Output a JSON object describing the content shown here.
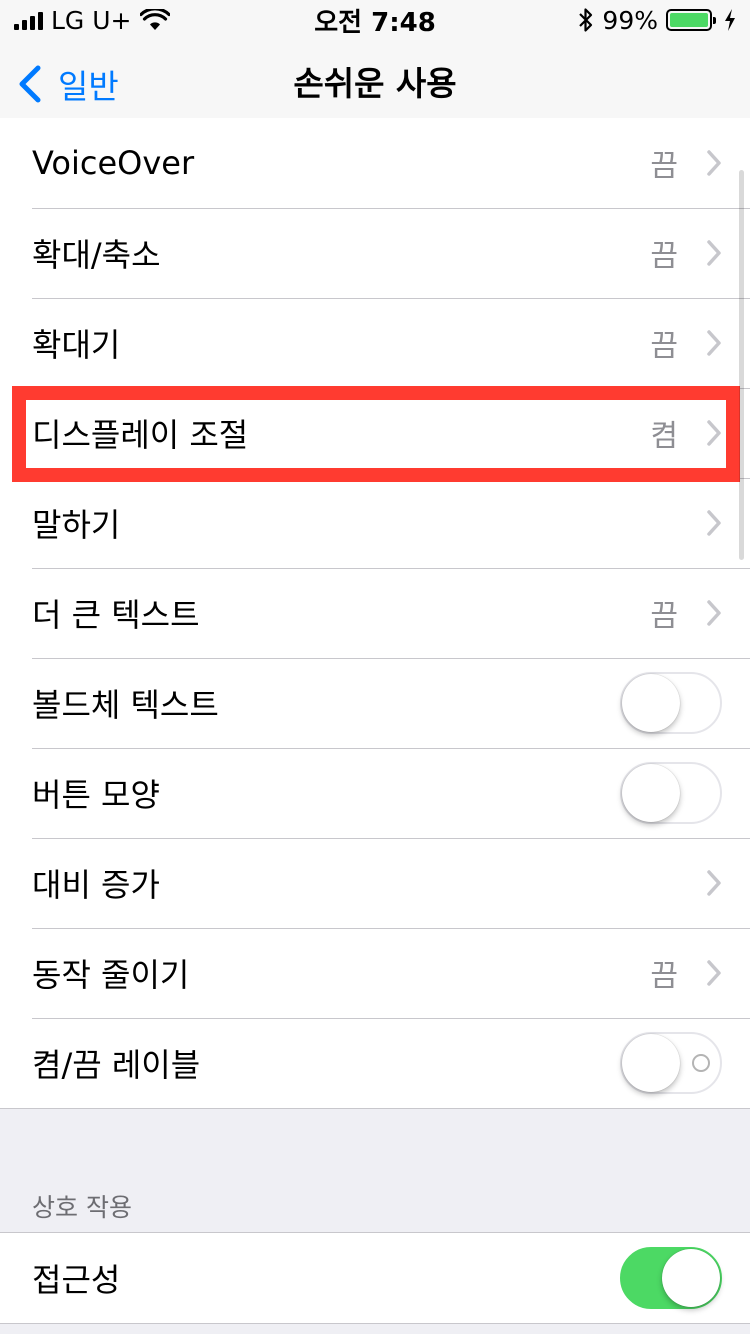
{
  "status_bar": {
    "carrier": "LG U+",
    "time": "오전 7:48",
    "battery_percent": "99%",
    "battery_level": 0.99,
    "icons": [
      "signal-icon",
      "wifi-icon",
      "bluetooth-icon",
      "battery-icon",
      "charging-icon"
    ]
  },
  "nav": {
    "back_label": "일반",
    "title": "손쉬운 사용"
  },
  "rows": [
    {
      "label": "VoiceOver",
      "value": "끔"
    },
    {
      "label": "확대/축소",
      "value": "끔"
    },
    {
      "label": "확대기",
      "value": "끔"
    },
    {
      "label": "디스플레이 조절",
      "value": "켬"
    },
    {
      "label": "말하기"
    },
    {
      "label": "더 큰 텍스트",
      "value": "끔"
    },
    {
      "label": "볼드체 텍스트",
      "toggle": false
    },
    {
      "label": "버튼 모양",
      "toggle": false
    },
    {
      "label": "대비 증가"
    },
    {
      "label": "동작 줄이기",
      "value": "끔"
    },
    {
      "label": "켬/끔 레이블",
      "toggle": false
    }
  ],
  "section_interaction": {
    "header": "상호 작용",
    "rows": [
      {
        "label": "접근성",
        "toggle": true
      }
    ]
  },
  "colors": {
    "accent": "#007aff",
    "toggle_on": "#4cd964",
    "highlight": "#ff3b30"
  }
}
